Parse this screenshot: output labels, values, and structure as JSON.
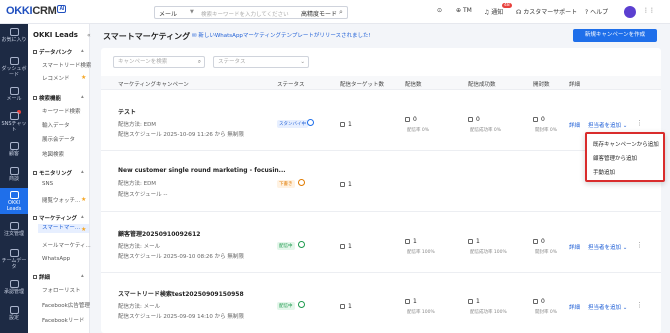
{
  "topbar": {
    "logo_main": "OKKI",
    "logo_crm": "CRM",
    "logo_ai": "AI",
    "search_type": "メール",
    "search_placeholder": "検索キーワードを入力してください",
    "search_mode": "高精度モード",
    "tm_label": "TM",
    "notify_label": "通知",
    "notify_count": "48",
    "support_label": "カスタマーサポート",
    "help_label": "ヘルプ"
  },
  "rail": {
    "items": [
      {
        "label": "お気に入り"
      },
      {
        "label": "ダッシュボード"
      },
      {
        "label": "メール"
      },
      {
        "label": "SNSチャット"
      },
      {
        "label": "顧客"
      },
      {
        "label": "商談"
      },
      {
        "label": "OKKI Leads"
      },
      {
        "label": "注文管理"
      },
      {
        "label": "チームデータ"
      },
      {
        "label": "承認管理"
      },
      {
        "label": "設定"
      }
    ]
  },
  "subnav": {
    "title": "OKKI Leads",
    "groups": [
      {
        "label": "データバンク",
        "items": [
          "スマートリード検索",
          "レコメンド"
        ]
      },
      {
        "label": "検索機能",
        "items": [
          "キーワード検索",
          "輸入データ",
          "展示会データ",
          "地図検索"
        ]
      },
      {
        "label": "モニタリング",
        "items": [
          "SNS",
          "閲覧ウォッチ..."
        ]
      },
      {
        "label": "マーケティング",
        "items": [
          "スマートマー...",
          "メールマーケティ...",
          "WhatsApp"
        ]
      },
      {
        "label": "詳細",
        "items": [
          "フォローリスト",
          "Facebook広告管理",
          "Facebookリード"
        ]
      }
    ]
  },
  "main": {
    "title": "スマートマーケティング",
    "announcement": "新しいWhatsAppマーケティングテンプレートがリリースされました!",
    "new_button": "新規キャンペーンを作成",
    "filter_search_placeholder": "キャンペーンを検索",
    "filter_status_placeholder": "ステータス",
    "columns": [
      "マーケティングキャンペーン",
      "ステータス",
      "配信ターゲット数",
      "配信数",
      "配信成功数",
      "開封数",
      "詳細"
    ],
    "rows": [
      {
        "name": "テスト",
        "method": "配信方法:  EDM",
        "schedule": "配信スケジュール  2025-10-09 11:26 から  無制限",
        "status": "スタンバイ中",
        "targets": "1",
        "sent": "0",
        "sent_rate": "配信率 0%",
        "success": "0",
        "success_rate": "配信成功率 0%",
        "opened": "0",
        "open_rate": "開封率 0%",
        "detail": "詳細",
        "assign": "担当者を追加"
      },
      {
        "name": "New customer single round marketing - focusin...",
        "method": "配信方法:  EDM",
        "schedule": "配信スケジュール  --",
        "status": "下書き",
        "targets": "1",
        "sent": "",
        "sent_rate": "",
        "success": "",
        "success_rate": "",
        "opened": "",
        "open_rate": "",
        "detail": "",
        "assign": ""
      },
      {
        "name": "顧客管理20250910092612",
        "method": "配信方法:  メール",
        "schedule": "配信スケジュール  2025-09-10 08:26 から  無制限",
        "status": "配信中",
        "targets": "1",
        "sent": "1",
        "sent_rate": "配信率 100%",
        "success": "1",
        "success_rate": "配信成功率 100%",
        "opened": "0",
        "open_rate": "開封率 0%",
        "detail": "詳細",
        "assign": "担当者を追加"
      },
      {
        "name": "スマートリード検索test20250909150958",
        "method": "配信方法:  メール",
        "schedule": "配信スケジュール  2025-09-09 14:10 から  無制限",
        "status": "配信中",
        "targets": "1",
        "sent": "1",
        "sent_rate": "配信率 100%",
        "success": "1",
        "success_rate": "配信成功率 100%",
        "opened": "0",
        "open_rate": "開封率 0%",
        "detail": "詳細",
        "assign": "担当者を追加"
      }
    ]
  },
  "dropdown": {
    "items": [
      "既存キャンペーンから追加",
      "顧客管理から追加",
      "手動追加"
    ]
  }
}
